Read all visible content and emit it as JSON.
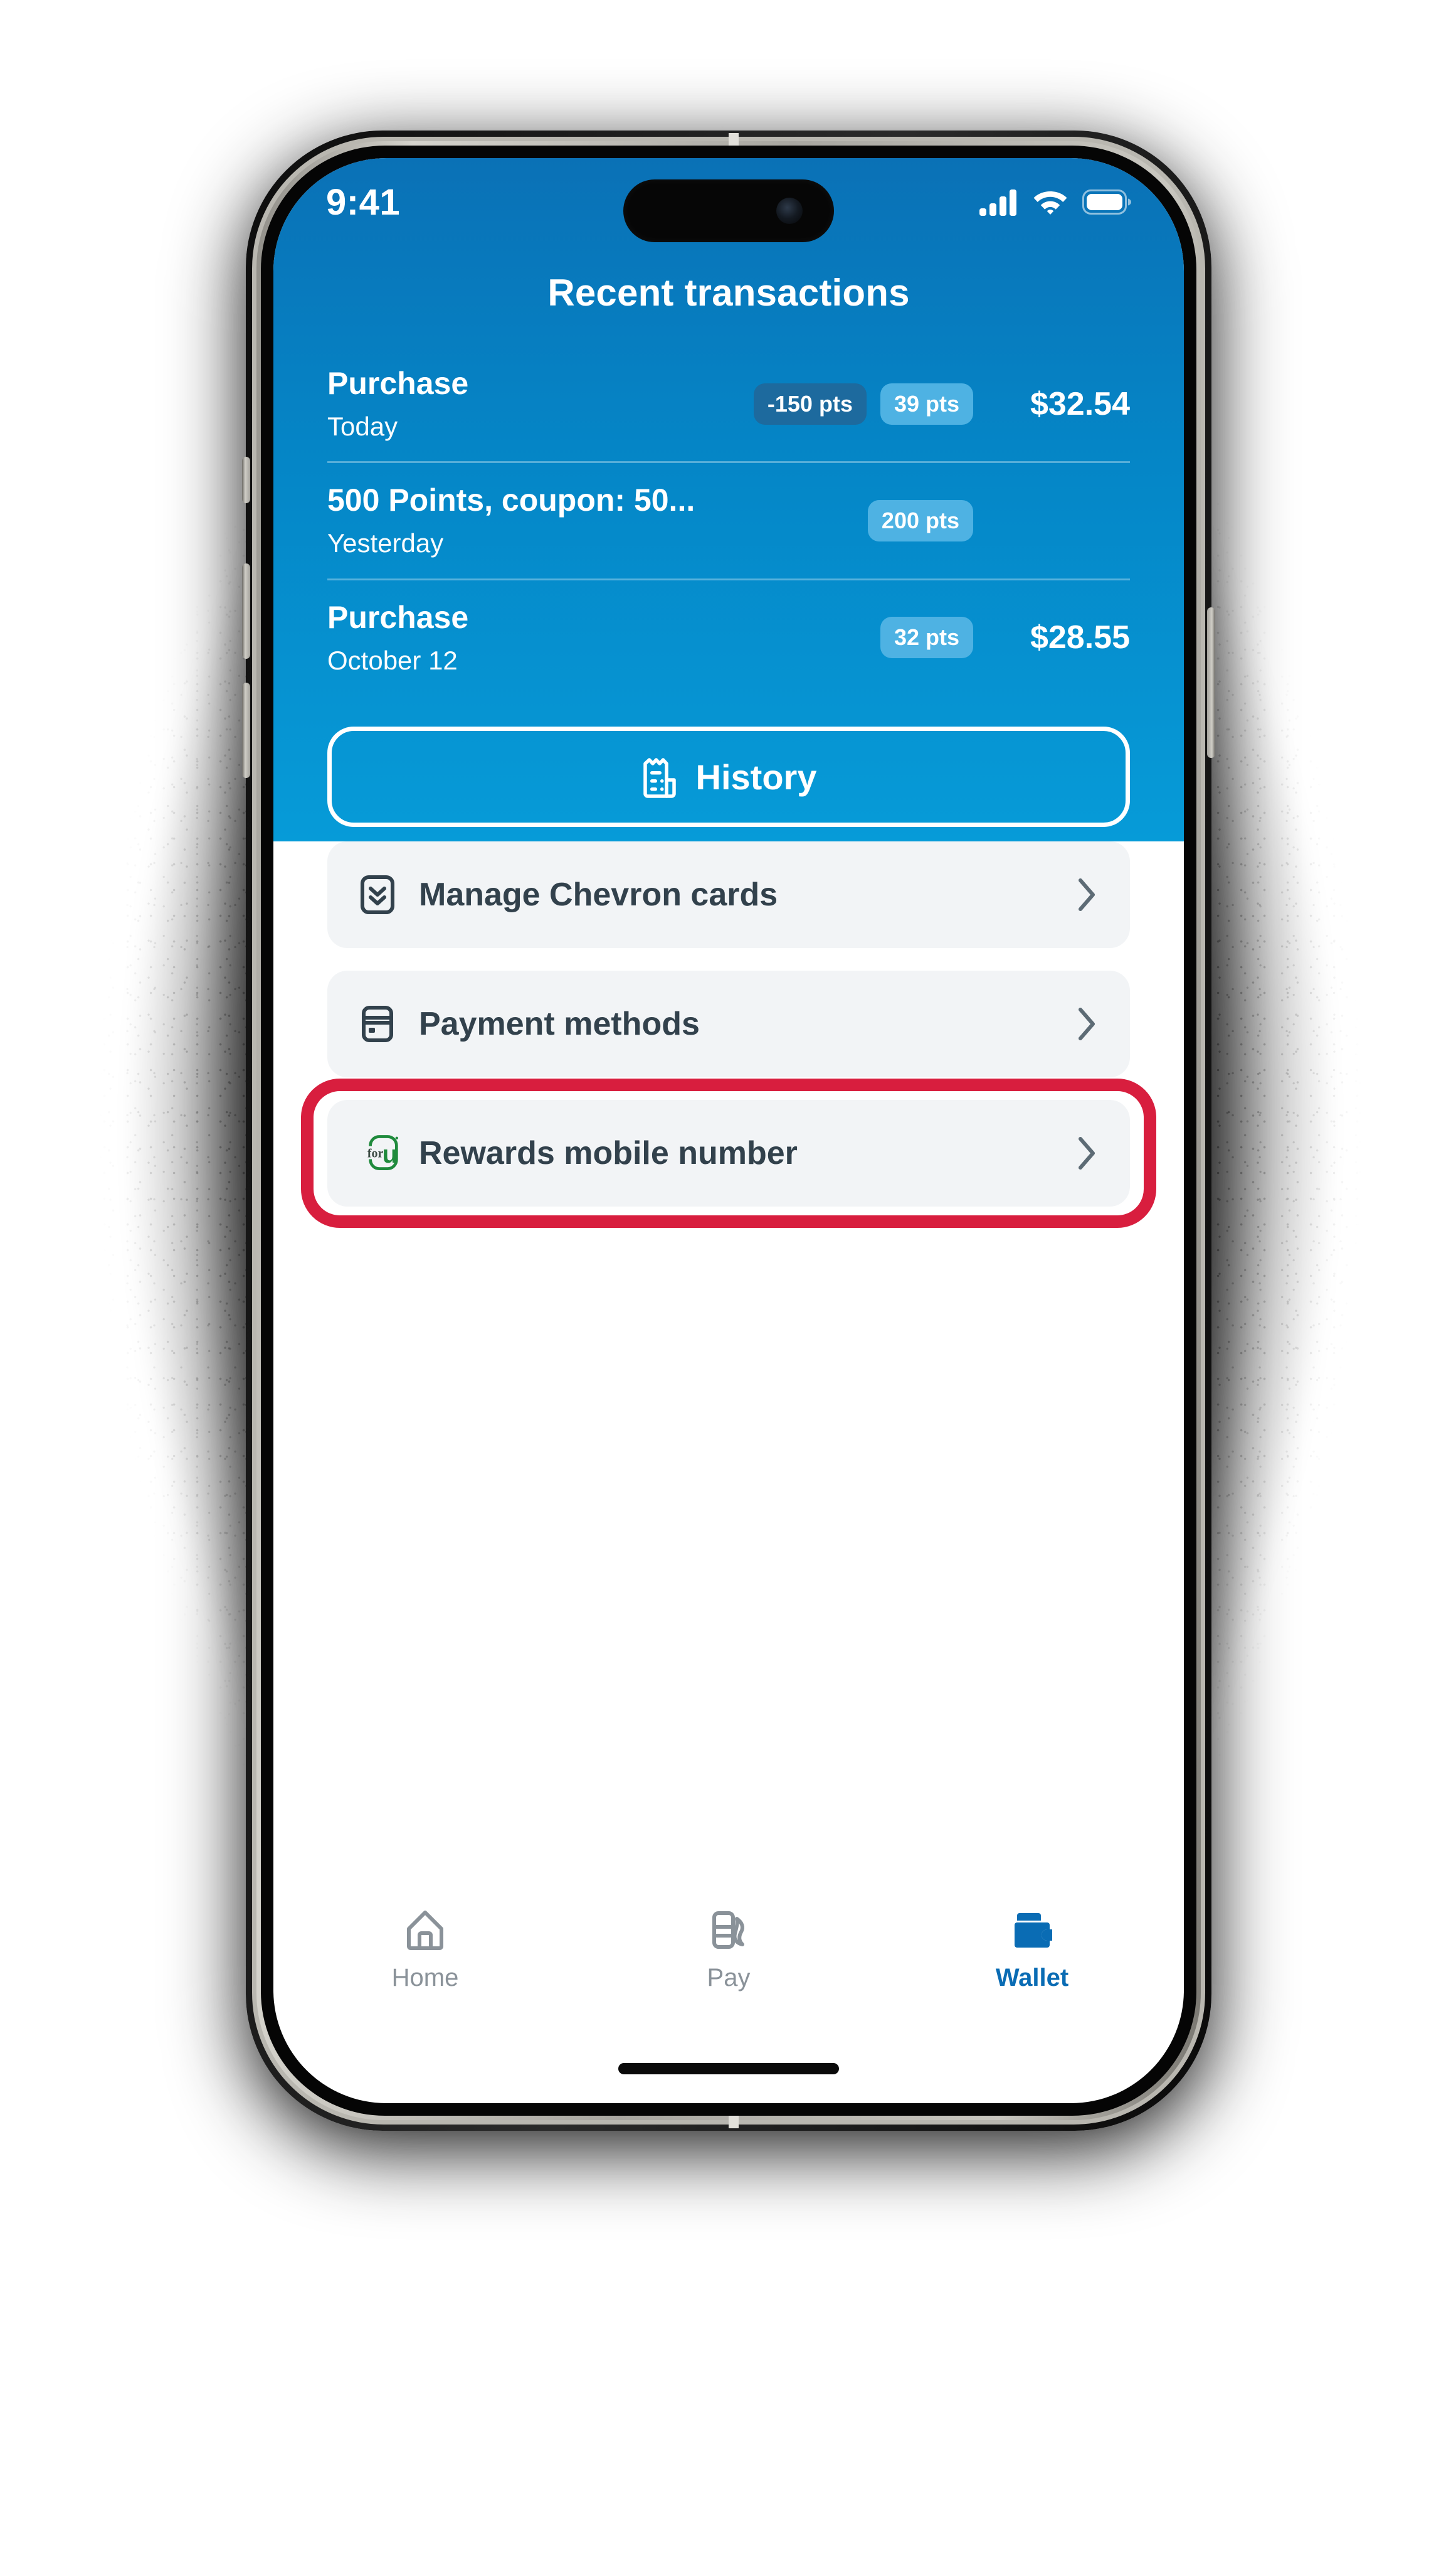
{
  "status_bar": {
    "time": "9:41",
    "icons": [
      "cellular-signal-icon",
      "wifi-icon",
      "battery-icon"
    ]
  },
  "hero": {
    "title": "Recent transactions",
    "background_color": "#0585c6"
  },
  "transactions": [
    {
      "title": "Purchase",
      "date": "Today",
      "badge_negative": "-150 pts",
      "badge_positive": "39 pts",
      "amount": "$32.54"
    },
    {
      "title": "500 Points, coupon: 50...",
      "date": "Yesterday",
      "badge_negative": "",
      "badge_positive": "200 pts",
      "amount": ""
    },
    {
      "title": "Purchase",
      "date": "October 12",
      "badge_negative": "",
      "badge_positive": "32 pts",
      "amount": "$28.55"
    }
  ],
  "history_button": {
    "label": "History",
    "icon": "receipt-icon"
  },
  "menu": {
    "items": [
      {
        "label": "Manage Chevron cards",
        "icon": "card-chevron-down-icon",
        "highlighted": false
      },
      {
        "label": "Payment methods",
        "icon": "credit-card-icon",
        "highlighted": false
      },
      {
        "label": "Rewards mobile number",
        "icon": "for-u-logo-icon",
        "highlighted": true
      }
    ],
    "highlight_color": "#d81e3e"
  },
  "tabbar": {
    "items": [
      {
        "label": "Home",
        "icon": "house-icon",
        "active": false
      },
      {
        "label": "Pay",
        "icon": "fuel-pump-icon",
        "active": false
      },
      {
        "label": "Wallet",
        "icon": "wallet-icon",
        "active": true
      }
    ],
    "active_color": "#0a6cb4",
    "inactive_color": "#8a9299"
  }
}
